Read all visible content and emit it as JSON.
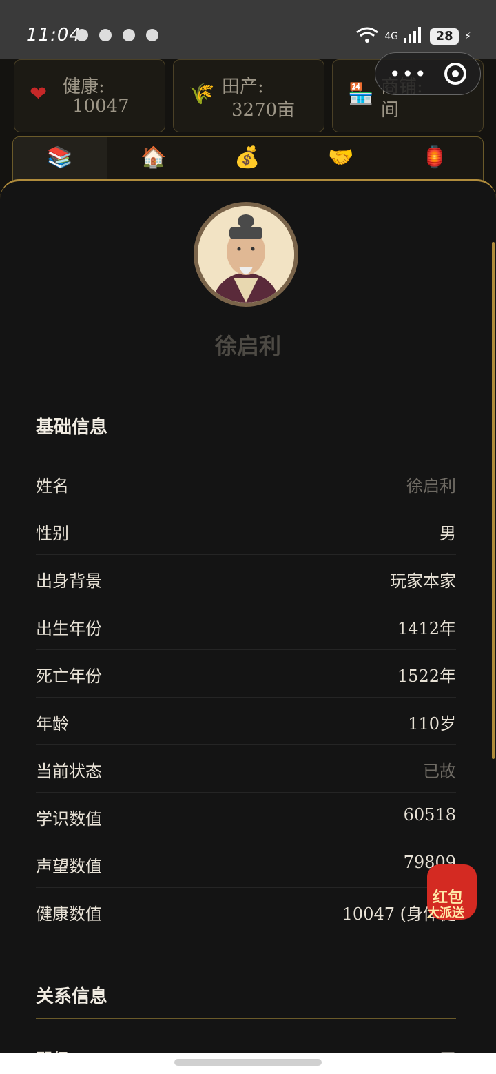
{
  "status_bar": {
    "time": "11:04",
    "battery": "28",
    "network": "4G"
  },
  "stats": [
    {
      "icon": "heart-icon",
      "glyph": "❤",
      "label": "健康:",
      "value": "10047"
    },
    {
      "icon": "rice-icon",
      "glyph": "🌾",
      "label": "田产:",
      "value": "3270亩"
    },
    {
      "icon": "shop-icon",
      "glyph": "🏪",
      "label": "商铺:",
      "value": "间"
    }
  ],
  "tabs": [
    {
      "icon": "books-icon",
      "glyph": "📚"
    },
    {
      "icon": "house-icon",
      "glyph": "🏠"
    },
    {
      "icon": "money-bag-icon",
      "glyph": "💰"
    },
    {
      "icon": "handshake-icon",
      "glyph": "🤝"
    },
    {
      "icon": "lantern-icon",
      "glyph": "🏮"
    }
  ],
  "profile": {
    "name": "徐启利"
  },
  "basic_info": {
    "title": "基础信息",
    "rows": [
      {
        "label": "姓名",
        "value": "徐启利",
        "muted": true
      },
      {
        "label": "性别",
        "value": "男"
      },
      {
        "label": "出身背景",
        "value": "玩家本家"
      },
      {
        "label": "出生年份",
        "value": "1412年"
      },
      {
        "label": "死亡年份",
        "value": "1522年"
      },
      {
        "label": "年龄",
        "value": "110岁"
      },
      {
        "label": "当前状态",
        "value": "已故",
        "muted": true
      },
      {
        "label": "学识数值",
        "value": "60518"
      },
      {
        "label": "声望数值",
        "value": "79809"
      },
      {
        "label": "健康数值",
        "value": "10047 (身体健"
      }
    ]
  },
  "relation_info": {
    "title": "关系信息",
    "rows": [
      {
        "label": "配偶",
        "value": "无"
      }
    ]
  },
  "promo": {
    "line1": "红包",
    "line2": "大派送"
  },
  "colors": {
    "accent": "#b08c3c",
    "background": "#141414",
    "redpacket": "#d42a22"
  }
}
